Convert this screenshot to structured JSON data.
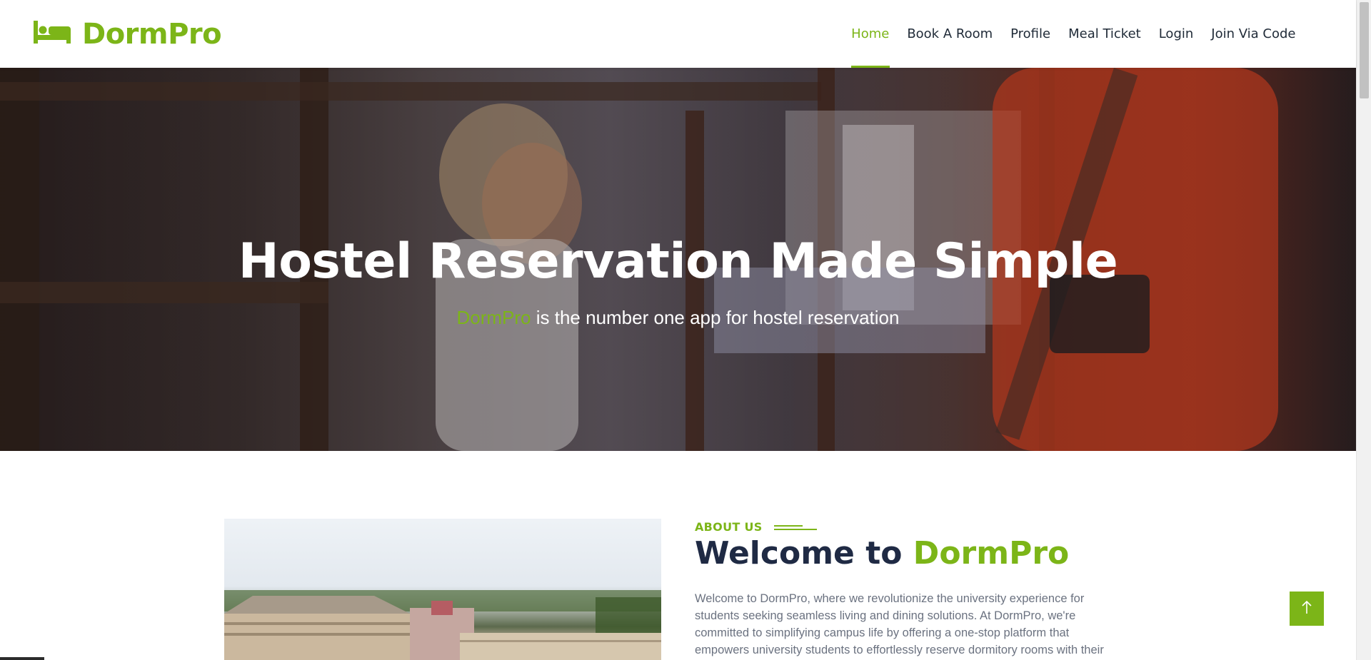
{
  "header": {
    "brand_name": "DormPro",
    "brand_icon": "bed-icon",
    "brand_color": "#7cb518"
  },
  "nav": {
    "items": [
      {
        "label": "Home",
        "active": true
      },
      {
        "label": "Book A Room",
        "active": false
      },
      {
        "label": "Profile",
        "active": false
      },
      {
        "label": "Meal Ticket",
        "active": false
      },
      {
        "label": "Login",
        "active": false
      },
      {
        "label": "Join Via Code",
        "active": false
      }
    ]
  },
  "hero": {
    "title": "Hostel Reservation Made Simple",
    "subtitle_brand": "DormPro",
    "subtitle_rest": " is the number one app for hostel reservation"
  },
  "about": {
    "label": "ABOUT US",
    "heading_prefix": "Welcome to ",
    "heading_brand": "DormPro",
    "paragraph": "Welcome to DormPro, where we revolutionize the university experience for students seeking seamless living and dining solutions. At DormPro, we're committed to simplifying campus life by offering a one-stop platform that empowers university students to effortlessly reserve dormitory rooms with their friends and manage"
  },
  "back_to_top": {
    "icon": "arrow-up-icon"
  },
  "colors": {
    "accent": "#7cb518",
    "heading": "#1f2a44",
    "body_text": "#6b7280"
  }
}
